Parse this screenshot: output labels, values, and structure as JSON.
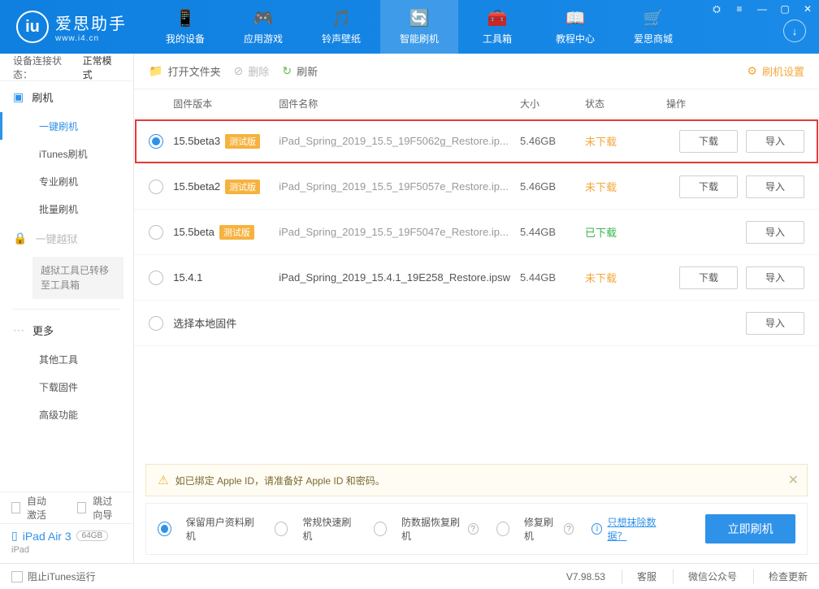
{
  "app": {
    "title": "爱思助手",
    "subtitle": "www.i4.cn"
  },
  "nav": [
    {
      "label": "我的设备",
      "icon": "📱"
    },
    {
      "label": "应用游戏",
      "icon": "🎮"
    },
    {
      "label": "铃声壁纸",
      "icon": "🎵"
    },
    {
      "label": "智能刷机",
      "icon": "🔄"
    },
    {
      "label": "工具箱",
      "icon": "🧰"
    },
    {
      "label": "教程中心",
      "icon": "📖"
    },
    {
      "label": "爱思商城",
      "icon": "🛒"
    }
  ],
  "nav_active_index": 3,
  "sidebar": {
    "conn_label": "设备连接状态：",
    "conn_value": "正常模式",
    "section1": {
      "title": "刷机"
    },
    "items1": [
      "一键刷机",
      "iTunes刷机",
      "专业刷机",
      "批量刷机"
    ],
    "active_item": 0,
    "section2": {
      "title": "一键越狱"
    },
    "note": "越狱工具已转移至工具箱",
    "section3": {
      "title": "更多"
    },
    "items3": [
      "其他工具",
      "下载固件",
      "高级功能"
    ],
    "auto_activate": "自动激活",
    "skip_guide": "跳过向导",
    "device": {
      "name": "iPad Air 3",
      "storage": "64GB",
      "type": "iPad"
    }
  },
  "toolbar": {
    "open_folder": "打开文件夹",
    "delete": "删除",
    "refresh": "刷新",
    "settings": "刷机设置"
  },
  "columns": {
    "version": "固件版本",
    "name": "固件名称",
    "size": "大小",
    "status": "状态",
    "ops": "操作"
  },
  "labels": {
    "beta_tag": "测试版",
    "download": "下载",
    "import": "导入",
    "local_select": "选择本地固件"
  },
  "firmwares": [
    {
      "version": "15.5beta3",
      "beta": true,
      "filename": "iPad_Spring_2019_15.5_19F5062g_Restore.ip...",
      "size": "5.46GB",
      "status": "未下载",
      "status_class": "st-und",
      "selected": true,
      "show_download": true
    },
    {
      "version": "15.5beta2",
      "beta": true,
      "filename": "iPad_Spring_2019_15.5_19F5057e_Restore.ip...",
      "size": "5.46GB",
      "status": "未下载",
      "status_class": "st-und",
      "selected": false,
      "show_download": true
    },
    {
      "version": "15.5beta",
      "beta": true,
      "filename": "iPad_Spring_2019_15.5_19F5047e_Restore.ip...",
      "size": "5.44GB",
      "status": "已下载",
      "status_class": "st-done",
      "selected": false,
      "show_download": false
    },
    {
      "version": "15.4.1",
      "beta": false,
      "filename": "iPad_Spring_2019_15.4.1_19E258_Restore.ipsw",
      "size": "5.44GB",
      "status": "未下载",
      "status_class": "st-und",
      "selected": false,
      "show_download": true
    }
  ],
  "notice": "如已绑定 Apple ID，请准备好 Apple ID 和密码。",
  "options": {
    "opt1": "保留用户资料刷机",
    "opt2": "常规快速刷机",
    "opt3": "防数据恢复刷机",
    "opt4": "修复刷机",
    "erase_link": "只想抹除数据？",
    "primary": "立即刷机",
    "selected": 0
  },
  "statusbar": {
    "block_itunes": "阻止iTunes运行",
    "version": "V7.98.53",
    "cs": "客服",
    "wechat": "微信公众号",
    "update": "检查更新"
  }
}
